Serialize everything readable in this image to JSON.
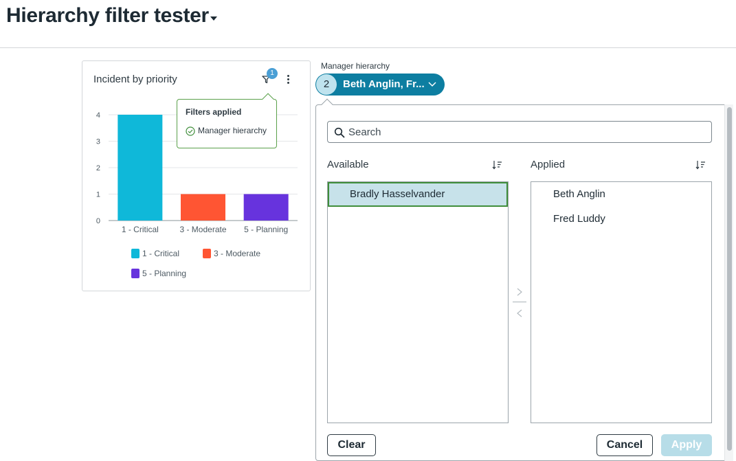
{
  "page": {
    "title": "Hierarchy filter tester"
  },
  "card": {
    "title": "Incident by priority",
    "filter_count": "1"
  },
  "tooltip": {
    "title": "Filters applied",
    "item": "Manager hierarchy"
  },
  "filter": {
    "label": "Manager hierarchy",
    "count": "2",
    "value": "Beth Anglin, Fr..."
  },
  "panel": {
    "search_placeholder": "Search",
    "available": {
      "header": "Available",
      "items": [
        "Bradly Hasselvander"
      ]
    },
    "applied": {
      "header": "Applied",
      "items": [
        "Beth Anglin",
        "Fred Luddy"
      ]
    },
    "buttons": {
      "clear": "Clear",
      "cancel": "Cancel",
      "apply": "Apply"
    }
  },
  "colors": {
    "brand": "#0d7ea1",
    "critical": "#0fb8d9",
    "moderate": "#ff5533",
    "planning": "#6733dd"
  },
  "chart_data": {
    "type": "bar",
    "title": "Incident by priority",
    "categories": [
      "1 - Critical",
      "3 - Moderate",
      "5 - Planning"
    ],
    "values": [
      4,
      1,
      1
    ],
    "colors": [
      "#0fb8d9",
      "#ff5533",
      "#6733dd"
    ],
    "ylim": [
      0,
      4
    ],
    "yticks": [
      0,
      1,
      2,
      3,
      4
    ],
    "grid": true,
    "legend": [
      "1 - Critical",
      "3 - Moderate",
      "5 - Planning"
    ],
    "legend_position": "bottom"
  }
}
